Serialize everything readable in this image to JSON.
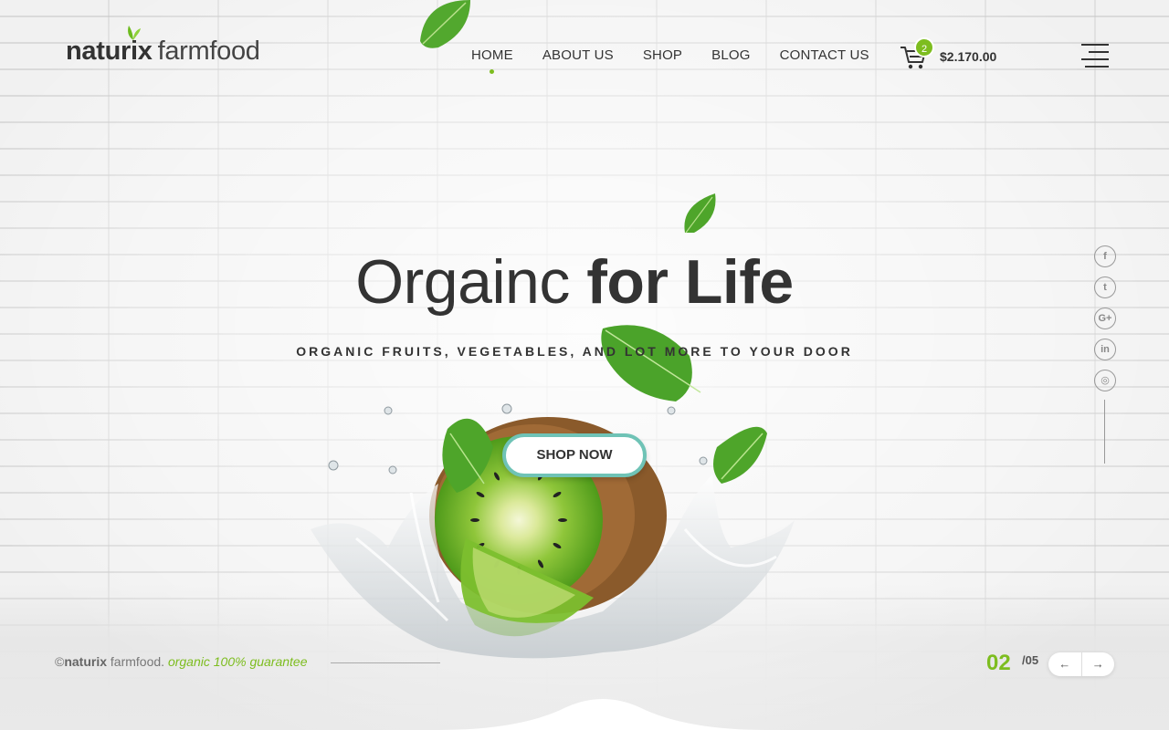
{
  "header": {
    "logo": {
      "bold": "naturix",
      "light": "farmfood"
    },
    "nav": [
      {
        "label": "HOME",
        "active": true
      },
      {
        "label": "ABOUT US"
      },
      {
        "label": "SHOP"
      },
      {
        "label": "BLOG"
      },
      {
        "label": "CONTACT US"
      }
    ],
    "cart": {
      "icon": "cart-icon",
      "count": "2",
      "total": "$2.170.00"
    },
    "menu_icon": "hamburger-icon"
  },
  "hero": {
    "title_light": "Orgainc",
    "title_bold": "for Life",
    "subtitle": "ORGANIC FRUITS, VEGETABLES, AND LOT MORE TO YOUR DOOR",
    "cta_label": "SHOP NOW"
  },
  "social": [
    {
      "icon": "facebook-icon",
      "glyph": "f"
    },
    {
      "icon": "twitter-icon",
      "glyph": "t"
    },
    {
      "icon": "google-plus-icon",
      "glyph": "G+"
    },
    {
      "icon": "linkedin-icon",
      "glyph": "in"
    },
    {
      "icon": "instagram-icon",
      "glyph": "◎"
    }
  ],
  "footer": {
    "copyright_prefix": "©",
    "brand_bold": "naturix",
    "brand_light": " farmfood.",
    "tagline": "organic 100% guarantee"
  },
  "slider": {
    "current": "02",
    "total": "/05",
    "prev": "←",
    "next": "→"
  },
  "colors": {
    "accent": "#7dbd1f",
    "button_border": "#6fc3b6",
    "text": "#333333"
  }
}
